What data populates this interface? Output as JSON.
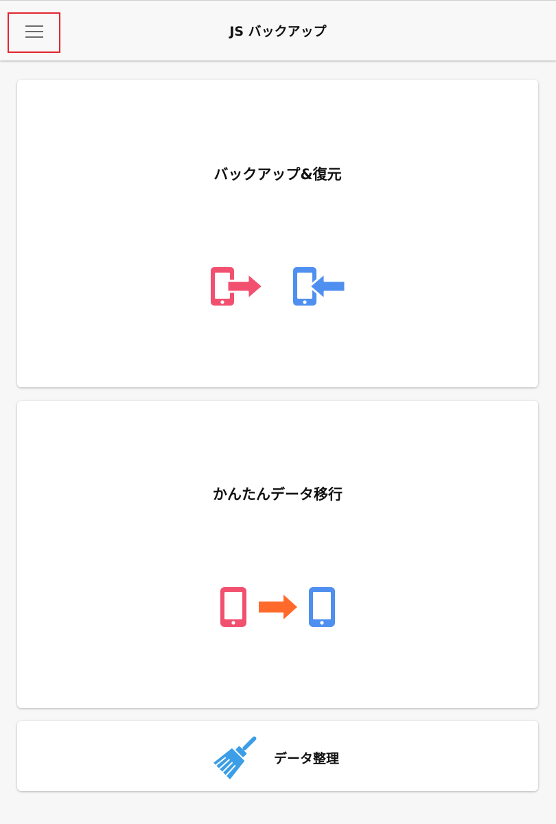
{
  "header": {
    "title": "JS バックアップ",
    "menu_icon": "hamburger-menu-icon",
    "menu_highlight_color": "#e0262e"
  },
  "cards": [
    {
      "title": "バックアップ&復元",
      "icons": [
        "phone-export-icon",
        "phone-import-icon"
      ]
    },
    {
      "title": "かんたんデータ移行",
      "icons": [
        "phone-source-icon",
        "transfer-arrow-icon",
        "phone-target-icon"
      ]
    },
    {
      "title": "データ整理",
      "icons": [
        "broom-icon"
      ]
    }
  ],
  "colors": {
    "pink": "#f1506f",
    "blue": "#4f8ff0",
    "orange": "#ff6a2b",
    "broom": "#3b9ee6"
  }
}
